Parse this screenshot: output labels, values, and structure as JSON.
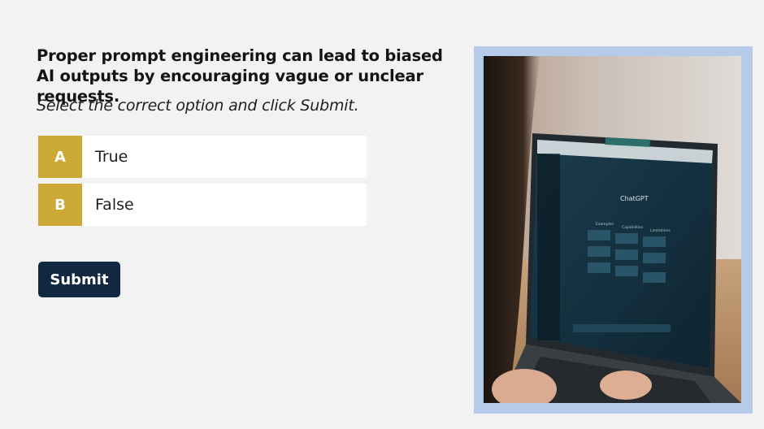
{
  "quiz": {
    "question": "Proper prompt engineering can lead to biased AI outputs by encouraging vague or unclear requests.",
    "instruction": "Select the correct option and click Submit.",
    "options": [
      {
        "letter": "A",
        "text": "True"
      },
      {
        "letter": "B",
        "text": "False"
      }
    ],
    "submit_label": "Submit"
  },
  "photo": {
    "screen_title": "ChatGPT",
    "columns": [
      "Examples",
      "Capabilities",
      "Limitations"
    ]
  },
  "colors": {
    "background": "#f2f2f2",
    "option_letter_bg": "#cca834",
    "submit_bg": "#112840",
    "photo_frame": "#b6caea"
  }
}
